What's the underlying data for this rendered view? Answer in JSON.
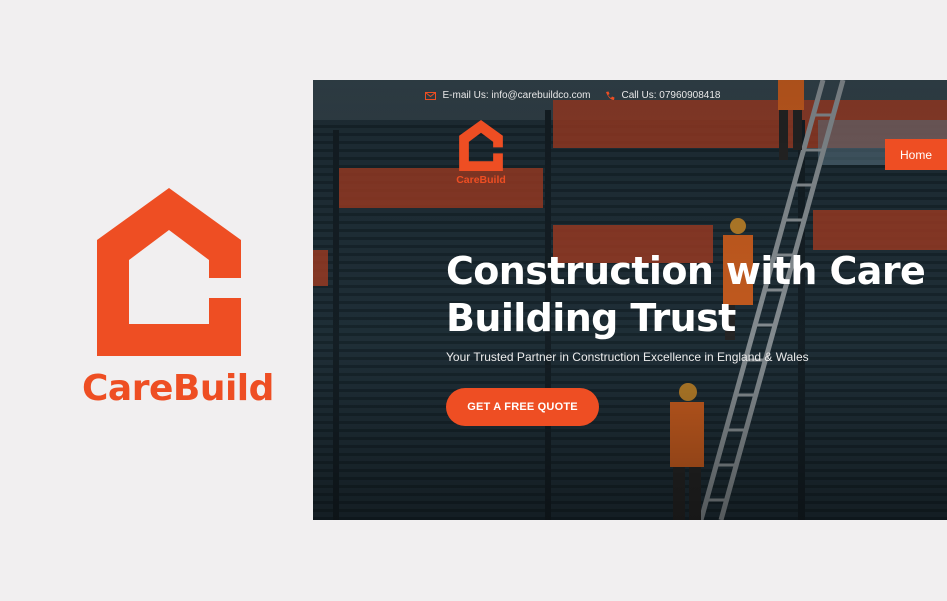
{
  "brand": {
    "name": "CareBuild",
    "logo_icon": "house-c-logo",
    "accent_color": "#ee4e23"
  },
  "website": {
    "topbar": {
      "email_icon": "envelope-icon",
      "email_text": "E-mail Us: info@carebuildco.com",
      "phone_icon": "phone-icon",
      "phone_text": "Call Us: 07960908418"
    },
    "logo_text": "CareBuild",
    "nav": {
      "home_label": "Home"
    },
    "hero": {
      "title_line1": "Construction with Care",
      "title_line2": "Building Trust",
      "subtitle": "Your Trusted Partner in Construction Excellence in England & Wales",
      "cta_label": "GET A FREE QUOTE"
    }
  }
}
